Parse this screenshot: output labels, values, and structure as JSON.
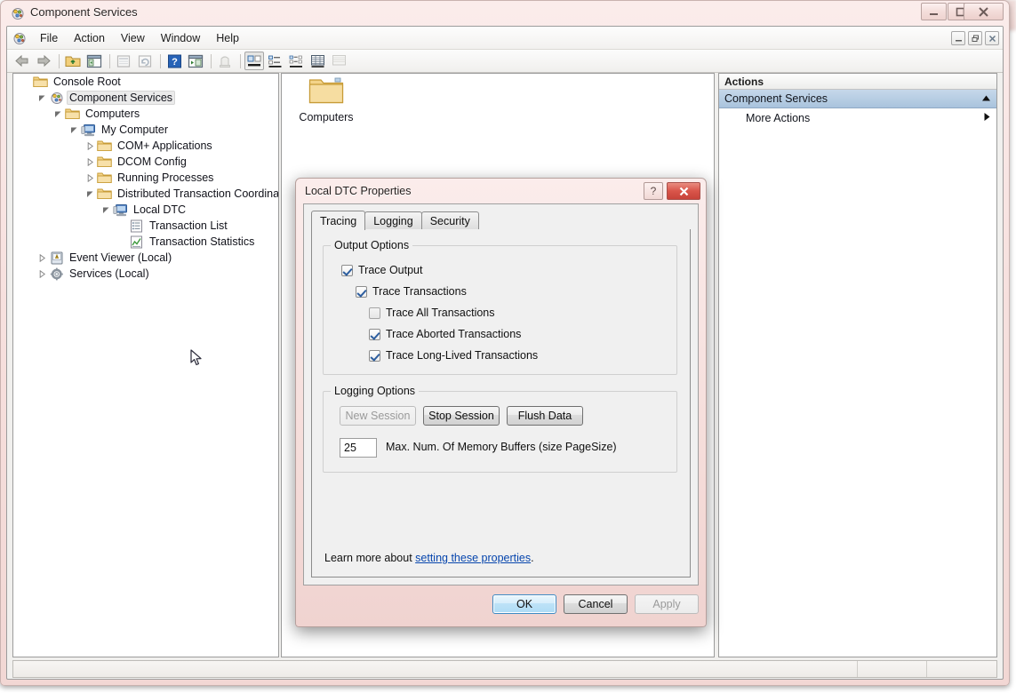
{
  "background_window": {
    "visible": true
  },
  "window": {
    "title": "Component Services",
    "icon": "component-services-icon",
    "controls": {
      "minimize": "–",
      "maximize": "□",
      "close": "✕"
    }
  },
  "menubar": {
    "items": [
      "File",
      "Action",
      "View",
      "Window",
      "Help"
    ],
    "mdi_controls": {
      "minimize": "–",
      "restore": "❐",
      "close": "✕"
    }
  },
  "toolbar": {
    "buttons": [
      {
        "name": "back-icon",
        "enabled": true
      },
      {
        "name": "forward-icon",
        "enabled": true
      },
      {
        "name": "up-folder-icon",
        "enabled": true
      },
      {
        "name": "show-hide-tree-icon",
        "enabled": true
      },
      {
        "name": "properties-icon",
        "enabled": false
      },
      {
        "name": "refresh-icon",
        "enabled": false
      },
      {
        "name": "help-icon",
        "enabled": true
      },
      {
        "name": "export-list-icon",
        "enabled": true
      },
      {
        "name": "new-object-icon",
        "enabled": false
      },
      {
        "name": "large-icons-icon",
        "enabled": true,
        "pressed": true
      },
      {
        "name": "small-icons-icon",
        "enabled": true
      },
      {
        "name": "list-view-icon",
        "enabled": true
      },
      {
        "name": "detail-view-icon",
        "enabled": true
      },
      {
        "name": "filter-icon",
        "enabled": false
      }
    ]
  },
  "tree": {
    "items": [
      {
        "label": "Console Root",
        "depth": 0,
        "icon": "folder-icon",
        "twisty": "",
        "selected": false
      },
      {
        "label": "Component Services",
        "depth": 1,
        "icon": "component-services-icon",
        "twisty": "expanded",
        "selected": true
      },
      {
        "label": "Computers",
        "depth": 2,
        "icon": "folder-icon",
        "twisty": "expanded",
        "selected": false
      },
      {
        "label": "My Computer",
        "depth": 3,
        "icon": "computer-icon",
        "twisty": "expanded",
        "selected": false
      },
      {
        "label": "COM+ Applications",
        "depth": 4,
        "icon": "folder-icon",
        "twisty": "collapsed",
        "selected": false
      },
      {
        "label": "DCOM Config",
        "depth": 4,
        "icon": "folder-icon",
        "twisty": "collapsed",
        "selected": false
      },
      {
        "label": "Running Processes",
        "depth": 4,
        "icon": "folder-icon",
        "twisty": "collapsed",
        "selected": false
      },
      {
        "label": "Distributed Transaction Coordinator",
        "depth": 4,
        "icon": "folder-icon",
        "twisty": "expanded",
        "selected": false
      },
      {
        "label": "Local DTC",
        "depth": 5,
        "icon": "computer-icon",
        "twisty": "expanded",
        "selected": false
      },
      {
        "label": "Transaction List",
        "depth": 6,
        "icon": "transaction-list-icon",
        "twisty": "",
        "selected": false
      },
      {
        "label": "Transaction Statistics",
        "depth": 6,
        "icon": "transaction-statistics-icon",
        "twisty": "",
        "selected": false
      },
      {
        "label": "Event Viewer (Local)",
        "depth": 1,
        "icon": "event-viewer-icon",
        "twisty": "collapsed",
        "selected": false
      },
      {
        "label": "Services (Local)",
        "depth": 1,
        "icon": "services-icon",
        "twisty": "collapsed",
        "selected": false
      }
    ]
  },
  "results": {
    "items": [
      {
        "label": "Computers",
        "icon": "folder-icon"
      }
    ]
  },
  "actions": {
    "header": "Actions",
    "group_label": "Component Services",
    "group_collapse_icon": "chevron-up-icon",
    "more_actions_label": "More Actions",
    "more_actions_icon": "chevron-right-icon"
  },
  "statusbar": {
    "text": ""
  },
  "dialog": {
    "title": "Local DTC Properties",
    "help_label": "?",
    "close_label": "✕",
    "tabs": [
      {
        "label": "Tracing",
        "active": true
      },
      {
        "label": "Logging",
        "active": false
      },
      {
        "label": "Security",
        "active": false
      }
    ],
    "output_options": {
      "title": "Output Options",
      "checkboxes": [
        {
          "label": "Trace Output",
          "checked": true,
          "indent": 0
        },
        {
          "label": "Trace Transactions",
          "checked": true,
          "indent": 1
        },
        {
          "label": "Trace All Transactions",
          "checked": false,
          "indent": 2
        },
        {
          "label": "Trace Aborted Transactions",
          "checked": true,
          "indent": 2
        },
        {
          "label": "Trace Long-Lived Transactions",
          "checked": true,
          "indent": 2
        }
      ]
    },
    "logging_options": {
      "title": "Logging Options",
      "buttons": [
        {
          "label": "New Session",
          "enabled": false
        },
        {
          "label": "Stop Session",
          "enabled": true
        },
        {
          "label": "Flush Data",
          "enabled": true
        }
      ],
      "buffer_value": "25",
      "buffer_label": "Max. Num. Of Memory Buffers (size PageSize)"
    },
    "learn_more": {
      "prefix": "Learn more about ",
      "link": "setting these properties",
      "suffix": "."
    },
    "footer_buttons": [
      {
        "label": "OK",
        "enabled": true,
        "default": true
      },
      {
        "label": "Cancel",
        "enabled": true,
        "default": false
      },
      {
        "label": "Apply",
        "enabled": false,
        "default": false
      }
    ]
  },
  "colors": {
    "window_frame": "#f3dcd9",
    "actions_group": "#a9c3dd",
    "link": "#0645ad",
    "close_red": "#d9554a",
    "default_button_blue": "#3d8bc4"
  }
}
